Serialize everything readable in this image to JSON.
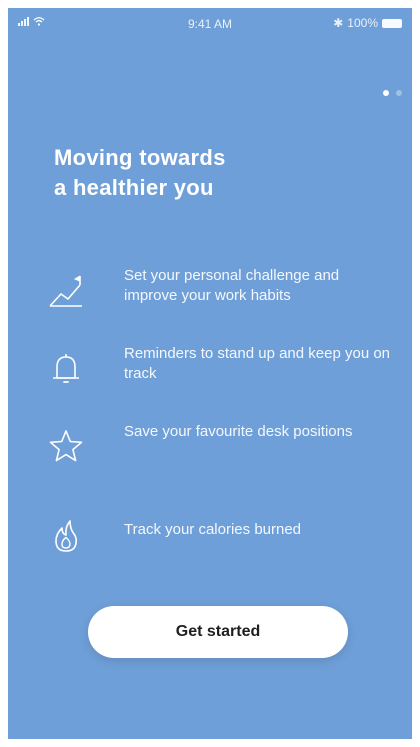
{
  "status_bar": {
    "time": "9:41 AM",
    "battery_label": "100%",
    "signal_icon": "signal-icon",
    "wifi_icon": "wifi-icon",
    "bluetooth_icon": "bluetooth-icon",
    "battery_icon": "battery-icon"
  },
  "pager": {
    "total": 2,
    "active_index": 0
  },
  "headline": {
    "line1": "Moving towards",
    "line2": "a healthier you"
  },
  "features": [
    {
      "icon": "chart-trend-icon",
      "text": "Set your personal challenge and improve your work habits"
    },
    {
      "icon": "bell-icon",
      "text": "Reminders to stand up and keep you on track"
    },
    {
      "icon": "star-icon",
      "text": "Save your favourite desk positions"
    },
    {
      "icon": "flame-icon",
      "text": "Track your calories burned"
    }
  ],
  "cta": {
    "label": "Get started"
  },
  "colors": {
    "background": "#6f9fd8",
    "text": "#ffffff",
    "button_bg": "#ffffff",
    "button_text": "#1f1f1f"
  }
}
